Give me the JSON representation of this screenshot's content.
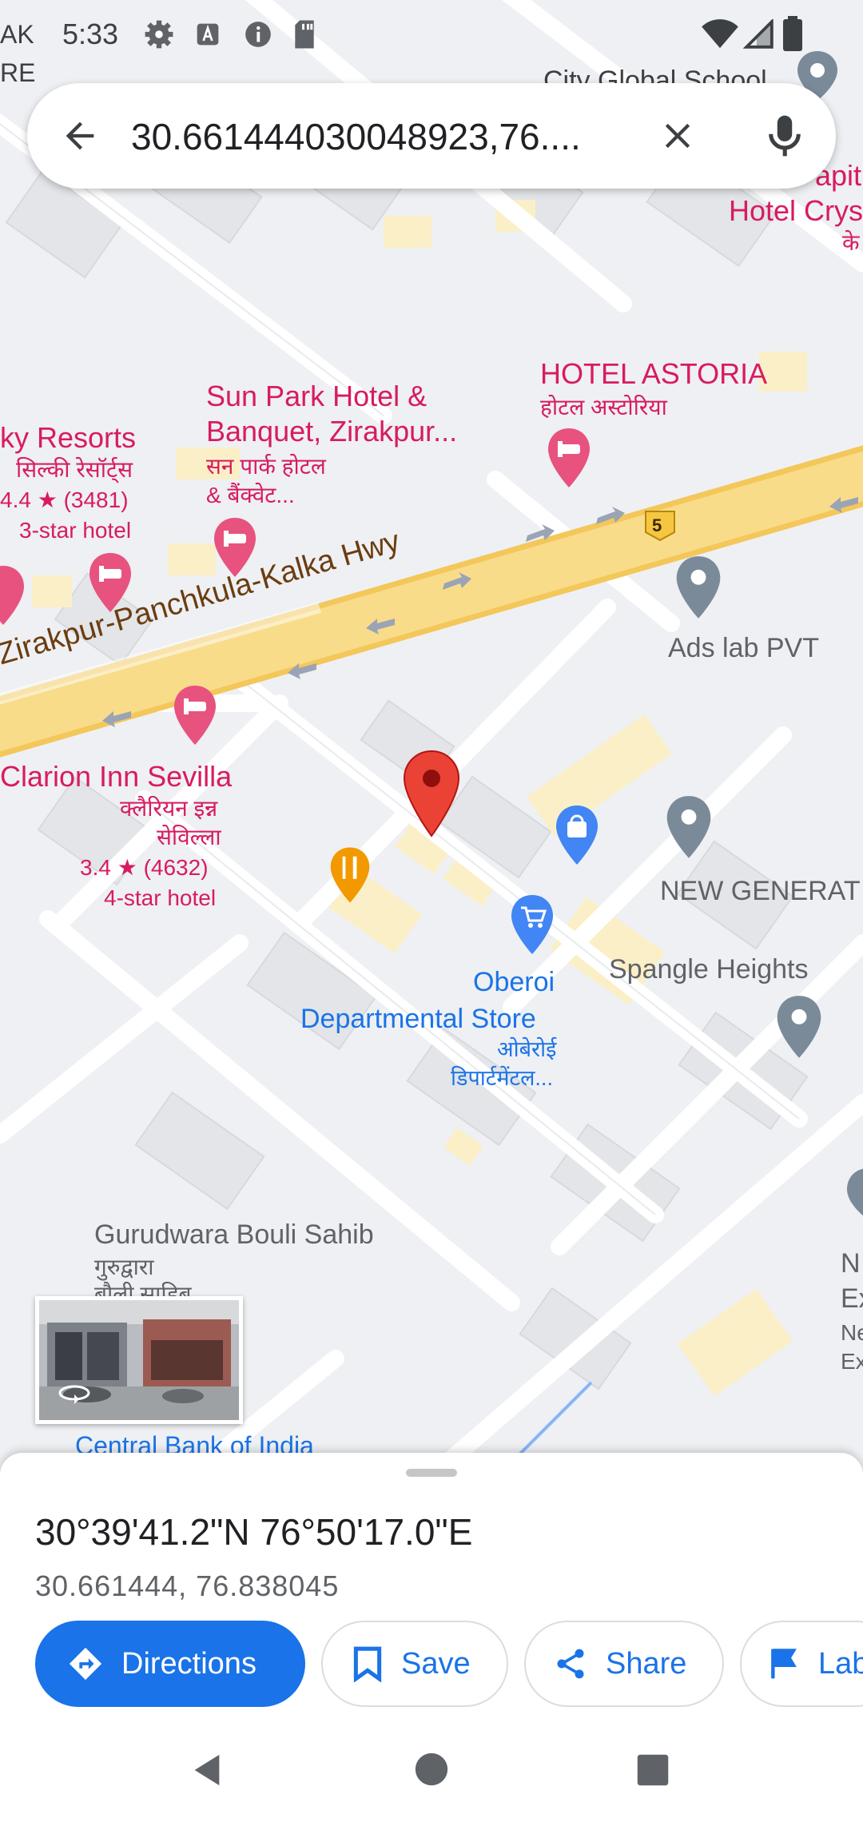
{
  "status_bar": {
    "time": "5:33",
    "left_icons": [
      "settings-icon",
      "font-icon",
      "info-icon",
      "sd-card-icon"
    ],
    "right_icons": [
      "wifi-icon",
      "signal-icon",
      "battery-icon"
    ]
  },
  "search": {
    "query": "30.661444030048923,76....",
    "back_icon": "arrow-back-icon",
    "clear_icon": "close-icon",
    "voice_icon": "mic-icon"
  },
  "map": {
    "edge_labels": {
      "top_left_1": "AK",
      "top_left_2": "RE",
      "city_global_school": "City Global School",
      "hotel_crys_1": "apit",
      "hotel_crys_2": "Hotel Crys",
      "hotel_crys_3": "के"
    },
    "places": {
      "sun_park_1": "Sun Park Hotel &",
      "sun_park_2": "Banquet, Zirakpur...",
      "sun_park_hi_1": "सन पार्क होटल",
      "sun_park_hi_2": "& बैंक्वेट...",
      "hotel_astoria": "HOTEL ASTORIA",
      "hotel_astoria_hi": "होटल अस्टोरिया",
      "silky_1": "ky Resorts",
      "silky_hi": "सिल्की रेसॉर्ट्स",
      "silky_rating": "4.4 ★ (3481)",
      "silky_type": "3-star hotel",
      "road": "Zirakpur-Panchkula-Kalka Hwy",
      "highway_no": "5",
      "ads_lab": "Ads lab PVT",
      "clarion_1": "Clarion Inn Sevilla",
      "clarion_hi_1": "क्लैरियन इन्न",
      "clarion_hi_2": "सेविल्ला",
      "clarion_rating": "3.4 ★ (4632)",
      "clarion_type": "4-star hotel",
      "new_generat": "NEW GENERAT",
      "spangle": "Spangle Heights",
      "oberoi_1": "Oberoi",
      "oberoi_2": "Departmental Store",
      "oberoi_hi_1": "ओबेरोई",
      "oberoi_hi_2": "डिपार्टमेंटल...",
      "gurudwara_1": "Gurudwara Bouli Sahib",
      "gurudwara_hi": "गुरुद्वारा",
      "gurudwara_hi_2": "बौली साहिब",
      "central_bank": "Central Bank of India",
      "right_n": "N",
      "right_ex": "Ex",
      "right_ne": "Ne",
      "right_ex2": "Ex"
    }
  },
  "sheet": {
    "title": "30°39'41.2\"N 76°50'17.0\"E",
    "subtitle": "30.661444, 76.838045",
    "buttons": {
      "directions": "Directions",
      "save": "Save",
      "share": "Share",
      "label": "Lab"
    }
  },
  "colors": {
    "accent": "#1a73e8",
    "pin_red": "#ea4335",
    "hotel_pink": "#d81b60",
    "road_yellow": "#f6d878",
    "map_bg": "#eef0f3"
  },
  "nav_icons": [
    "back-triangle-icon",
    "home-circle-icon",
    "recents-square-icon"
  ]
}
